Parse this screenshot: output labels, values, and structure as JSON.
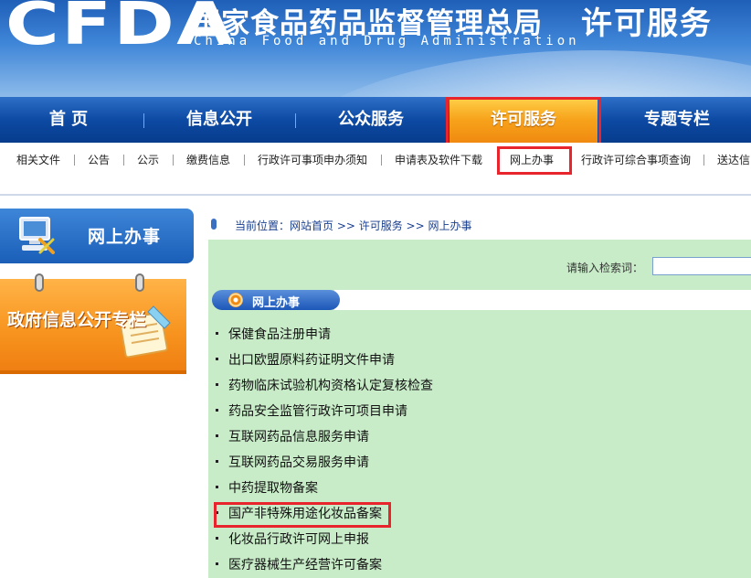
{
  "banner": {
    "logo_text": "CFDA",
    "org_name_cn": "国家食品药品监督管理总局",
    "org_name_en": "China Food and Drug Administration",
    "section_title": "许可服务"
  },
  "main_nav": {
    "items": [
      {
        "label": "首  页"
      },
      {
        "label": "信息公开"
      },
      {
        "label": "公众服务"
      },
      {
        "label": "许可服务"
      },
      {
        "label": "专题专栏"
      }
    ],
    "active_index": 3
  },
  "sub_nav": {
    "items": [
      {
        "label": "相关文件"
      },
      {
        "label": "公告"
      },
      {
        "label": "公示"
      },
      {
        "label": "缴费信息"
      },
      {
        "label": "行政许可事项申办须知"
      },
      {
        "label": "申请表及软件下载"
      },
      {
        "label": "网上办事"
      },
      {
        "label": "行政许可综合事项查询"
      },
      {
        "label": "送达信"
      }
    ],
    "active_index": 6
  },
  "left": {
    "online_panel_label": "网上办事",
    "gov_panel_label": "政府信息公开专栏"
  },
  "breadcrumb": {
    "text": "当前位置：网站首页 >> 许可服务 >> 网上办事"
  },
  "search": {
    "label": "请输入检索词：",
    "value": ""
  },
  "section": {
    "title": "网上办事",
    "items": [
      {
        "label": "保健食品注册申请"
      },
      {
        "label": "出口欧盟原料药证明文件申请"
      },
      {
        "label": "药物临床试验机构资格认定复核检查"
      },
      {
        "label": "药品安全监管行政许可项目申请"
      },
      {
        "label": "互联网药品信息服务申请"
      },
      {
        "label": "互联网药品交易服务申请"
      },
      {
        "label": "中药提取物备案"
      },
      {
        "label": "国产非特殊用途化妆品备案"
      },
      {
        "label": "化妆品行政许可网上申报"
      },
      {
        "label": "医疗器械生产经营许可备案"
      }
    ],
    "highlighted_index": 7
  },
  "colors": {
    "highlight_border": "#e8242c",
    "nav_blue": "#0d4aa3",
    "nav_active_orange": "#f7a21b",
    "content_green": "#c8ecc8"
  }
}
